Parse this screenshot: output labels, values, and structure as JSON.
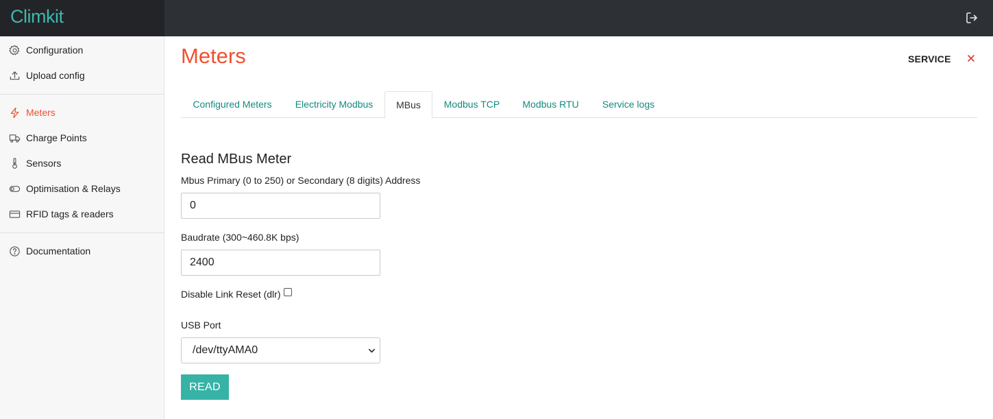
{
  "app": {
    "brand": "Climkit"
  },
  "sidebar": {
    "items": [
      {
        "label": "Configuration",
        "icon": "gear-icon"
      },
      {
        "label": "Upload config",
        "icon": "upload-icon"
      },
      {
        "label": "Meters",
        "icon": "lightning-icon",
        "active": true
      },
      {
        "label": "Charge Points",
        "icon": "truck-icon"
      },
      {
        "label": "Sensors",
        "icon": "thermometer-icon"
      },
      {
        "label": "Optimisation & Relays",
        "icon": "toggle-icon"
      },
      {
        "label": "RFID tags & readers",
        "icon": "card-icon"
      },
      {
        "label": "Documentation",
        "icon": "help-circle-icon"
      }
    ]
  },
  "header": {
    "title": "Meters",
    "service_label": "SERVICE"
  },
  "tabs": [
    {
      "label": "Configured Meters"
    },
    {
      "label": "Electricity Modbus"
    },
    {
      "label": "MBus",
      "active": true
    },
    {
      "label": "Modbus TCP"
    },
    {
      "label": "Modbus RTU"
    },
    {
      "label": "Service logs"
    }
  ],
  "form": {
    "title": "Read MBus Meter",
    "address_label": "Mbus Primary (0 to 250) or Secondary (8 digits) Address",
    "address_value": "0",
    "baudrate_label": "Baudrate (300~460.8K bps)",
    "baudrate_value": "2400",
    "dlr_label": "Disable Link Reset (dlr)",
    "dlr_checked": false,
    "usb_label": "USB Port",
    "usb_selected": "/dev/ttyAMA0",
    "read_button": "READ"
  },
  "colors": {
    "accent": "#ef5030",
    "teal": "#37b2a6",
    "tab_link": "#138a7f",
    "topbar": "#2d3136"
  }
}
